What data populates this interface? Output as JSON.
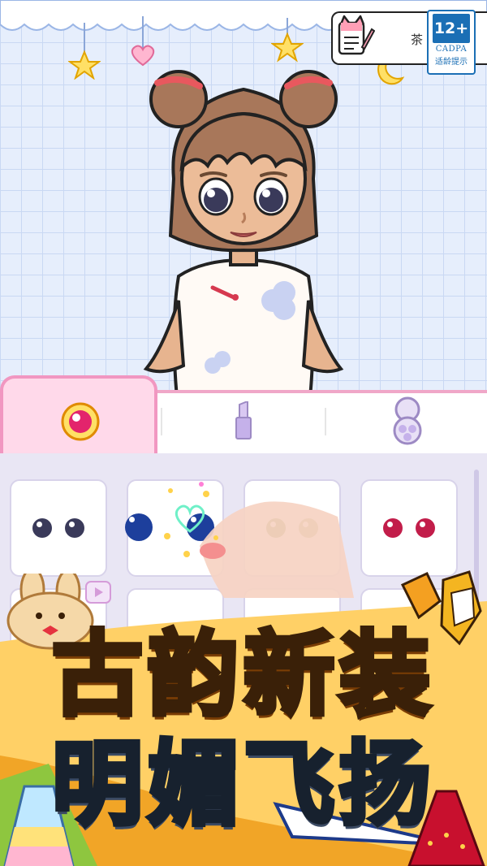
{
  "header": {
    "notes_label": "茶",
    "age_rating": {
      "number": "12+",
      "org": "CADPA",
      "tip": "适龄提示"
    }
  },
  "tabs": [
    {
      "icon": "eye-icon",
      "active": true
    },
    {
      "icon": "lipstick-icon",
      "active": false
    },
    {
      "icon": "blush-palette-icon",
      "active": false
    }
  ],
  "eye_options": [
    {
      "color": "#3a3a5a",
      "iris": "#4a4a6e"
    },
    {
      "color": "#1d3f9c",
      "iris": "#2f58c8"
    },
    {
      "color": "#7c8a3a",
      "iris": "#a5a060"
    },
    {
      "color": "#c21d4a",
      "iris": "#e03c68"
    }
  ],
  "banner": {
    "line1": "古韵新装",
    "line2": "明媚飞扬"
  },
  "colors": {
    "accent_pink": "#f197c1",
    "panel_bg": "#e9e6f4",
    "title_orange": "#ffb51a"
  }
}
